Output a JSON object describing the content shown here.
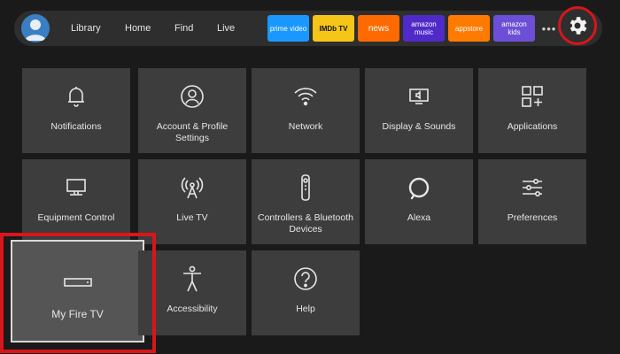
{
  "nav": {
    "links": [
      "Library",
      "Home",
      "Find",
      "Live"
    ],
    "apps": [
      {
        "label": "prime video",
        "color": "#1a98ff",
        "text": "#ffffff"
      },
      {
        "label": "IMDb TV",
        "color": "#f5c518",
        "text": "#111111"
      },
      {
        "label": "news",
        "color": "#ff6a00",
        "text": "#ffffff"
      },
      {
        "label": "amazon music",
        "color": "#4f2ac9",
        "text": "#ffffff"
      },
      {
        "label": "appstore",
        "color": "#ff7a00",
        "text": "#ffffff"
      },
      {
        "label": "amazon kids",
        "color": "#6c4fd6",
        "text": "#ffffff"
      }
    ],
    "more": "•••",
    "settings_icon": "gear-icon"
  },
  "settings_grid": [
    {
      "label": "Notifications",
      "icon": "bell-icon"
    },
    {
      "label": "Account & Profile Settings",
      "icon": "profile-icon"
    },
    {
      "label": "Network",
      "icon": "wifi-icon"
    },
    {
      "label": "Display & Sounds",
      "icon": "display-sound-icon"
    },
    {
      "label": "Applications",
      "icon": "apps-grid-icon"
    },
    {
      "label": "Equipment Control",
      "icon": "tv-icon"
    },
    {
      "label": "Live TV",
      "icon": "antenna-icon"
    },
    {
      "label": "Controllers & Bluetooth Devices",
      "icon": "remote-icon"
    },
    {
      "label": "Alexa",
      "icon": "alexa-icon"
    },
    {
      "label": "Preferences",
      "icon": "sliders-icon"
    },
    {
      "label": "My Fire TV",
      "icon": "fire-tv-stick-icon",
      "selected": true
    },
    {
      "label": "Accessibility",
      "icon": "accessibility-icon"
    },
    {
      "label": "Help",
      "icon": "help-icon"
    }
  ],
  "colors": {
    "highlight": "#d9151c",
    "tile": "#3d3d3d",
    "background": "#1a1a1a"
  }
}
